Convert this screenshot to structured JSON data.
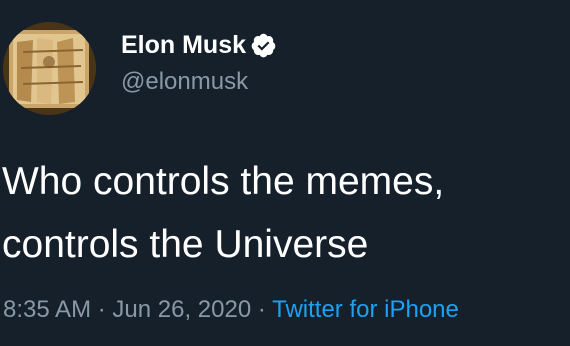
{
  "tweet": {
    "author": {
      "display_name": "Elon Musk",
      "handle": "@elonmusk",
      "verified": true,
      "avatar_icon": "profile-photo"
    },
    "text_lines": [
      "Who controls the memes,",
      "controls the Universe"
    ],
    "time": "8:35 AM",
    "date": "Jun 26, 2020",
    "separator": "·",
    "source": "Twitter for iPhone"
  },
  "colors": {
    "background": "#15202b",
    "text": "#ffffff",
    "secondary": "#8899a6",
    "accent": "#1da1f2"
  }
}
